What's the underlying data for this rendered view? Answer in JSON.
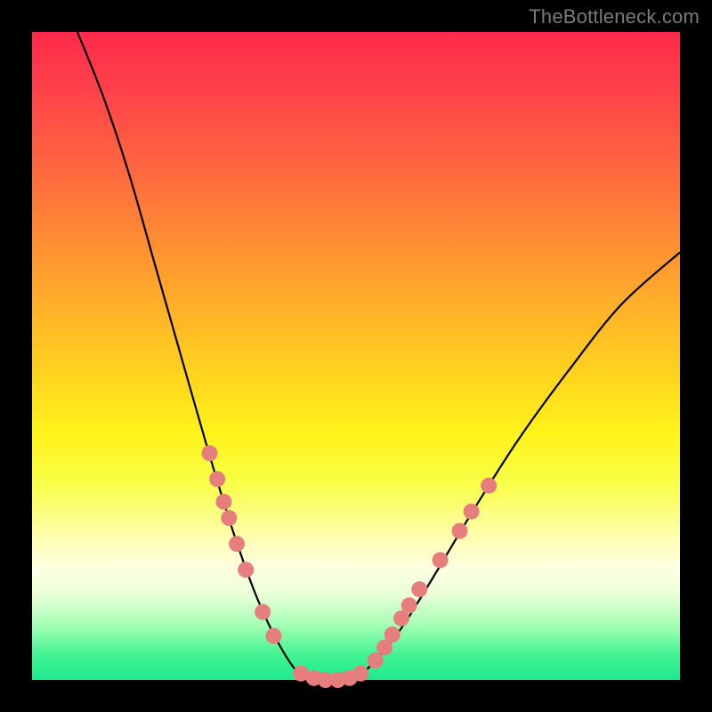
{
  "watermark": "TheBottleneck.com",
  "chart_data": {
    "type": "line",
    "title": "",
    "xlabel": "",
    "ylabel": "",
    "xlim": [
      0,
      100
    ],
    "ylim": [
      0,
      100
    ],
    "grid": false,
    "legend": false,
    "curve_points": [
      {
        "x": 7.0,
        "y": 100.0
      },
      {
        "x": 11.0,
        "y": 90.0
      },
      {
        "x": 15.0,
        "y": 78.0
      },
      {
        "x": 19.0,
        "y": 64.0
      },
      {
        "x": 23.0,
        "y": 50.0
      },
      {
        "x": 27.0,
        "y": 36.0
      },
      {
        "x": 31.0,
        "y": 23.0
      },
      {
        "x": 35.0,
        "y": 12.0
      },
      {
        "x": 39.0,
        "y": 4.0
      },
      {
        "x": 42.0,
        "y": 0.5
      },
      {
        "x": 46.0,
        "y": 0.0
      },
      {
        "x": 50.0,
        "y": 0.5
      },
      {
        "x": 53.0,
        "y": 3.0
      },
      {
        "x": 57.0,
        "y": 8.0
      },
      {
        "x": 62.0,
        "y": 16.0
      },
      {
        "x": 68.0,
        "y": 26.0
      },
      {
        "x": 75.0,
        "y": 37.0
      },
      {
        "x": 83.0,
        "y": 48.0
      },
      {
        "x": 91.0,
        "y": 58.0
      },
      {
        "x": 100.0,
        "y": 66.0
      }
    ],
    "markers_left": [
      {
        "x": 27.4,
        "y": 35.0
      },
      {
        "x": 28.6,
        "y": 31.0
      },
      {
        "x": 29.6,
        "y": 27.5
      },
      {
        "x": 30.4,
        "y": 25.0
      },
      {
        "x": 31.6,
        "y": 21.0
      },
      {
        "x": 33.0,
        "y": 17.0
      },
      {
        "x": 35.6,
        "y": 10.5
      },
      {
        "x": 37.3,
        "y": 6.8
      }
    ],
    "markers_bottom": [
      {
        "x": 41.5,
        "y": 1.0
      },
      {
        "x": 43.5,
        "y": 0.3
      },
      {
        "x": 45.3,
        "y": 0.0
      },
      {
        "x": 47.2,
        "y": 0.0
      },
      {
        "x": 49.0,
        "y": 0.3
      },
      {
        "x": 50.7,
        "y": 1.0
      }
    ],
    "markers_right": [
      {
        "x": 53.0,
        "y": 3.0
      },
      {
        "x": 54.4,
        "y": 5.0
      },
      {
        "x": 55.6,
        "y": 7.0
      },
      {
        "x": 57.0,
        "y": 9.5
      },
      {
        "x": 58.2,
        "y": 11.5
      },
      {
        "x": 59.8,
        "y": 14.0
      },
      {
        "x": 63.0,
        "y": 18.5
      },
      {
        "x": 66.0,
        "y": 23.0
      },
      {
        "x": 67.8,
        "y": 26.0
      },
      {
        "x": 70.5,
        "y": 30.0
      }
    ],
    "marker_radius": 9,
    "gradient_stops": [
      {
        "offset": 0.0,
        "color": "#ff2a4a"
      },
      {
        "offset": 0.08,
        "color": "#ff3f4a"
      },
      {
        "offset": 0.22,
        "color": "#ff6a3e"
      },
      {
        "offset": 0.36,
        "color": "#ff9a2f"
      },
      {
        "offset": 0.52,
        "color": "#ffd11f"
      },
      {
        "offset": 0.62,
        "color": "#fff31a"
      },
      {
        "offset": 0.7,
        "color": "#f8ff4a"
      },
      {
        "offset": 0.78,
        "color": "#feffb0"
      },
      {
        "offset": 0.83,
        "color": "#fdffe2"
      },
      {
        "offset": 0.87,
        "color": "#e8ffd6"
      },
      {
        "offset": 0.92,
        "color": "#9cffb0"
      },
      {
        "offset": 0.96,
        "color": "#44f393"
      },
      {
        "offset": 1.0,
        "color": "#1de98d"
      }
    ]
  }
}
